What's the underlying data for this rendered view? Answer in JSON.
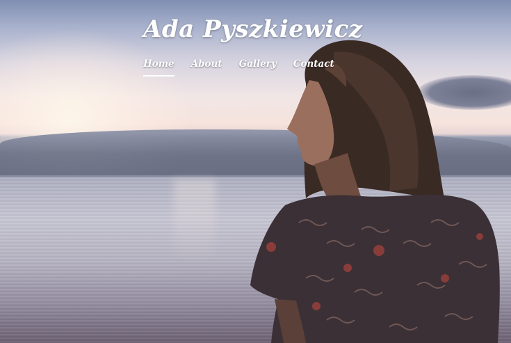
{
  "site": {
    "title": "Ada Pyszkiewicz"
  },
  "nav": {
    "items": [
      {
        "label": "Home",
        "active": true
      },
      {
        "label": "About",
        "active": false
      },
      {
        "label": "Gallery",
        "active": false
      },
      {
        "label": "Contact",
        "active": false
      }
    ]
  },
  "hero": {
    "image_subject": "woman-looking-at-sea-at-sunset"
  }
}
